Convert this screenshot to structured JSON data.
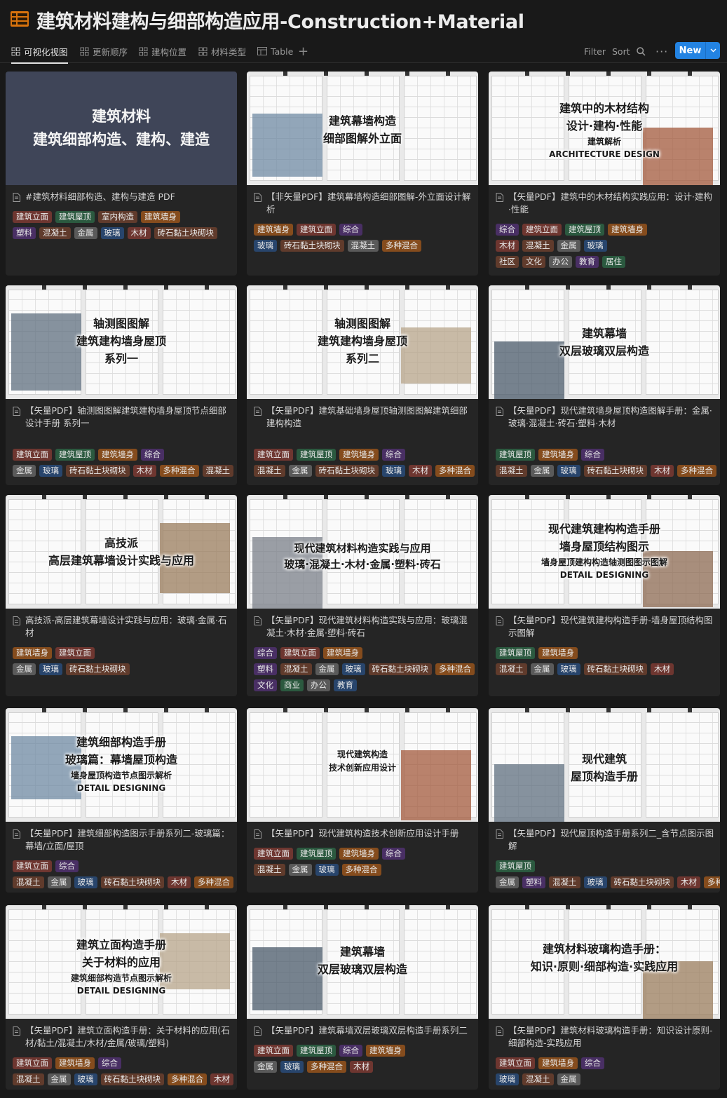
{
  "header": {
    "title": "建筑材料建构与细部构造应用-Construction+Material",
    "icon": "database-icon"
  },
  "tabs": [
    {
      "label": "可视化视图",
      "active": true
    },
    {
      "label": "更新顺序"
    },
    {
      "label": "建构位置"
    },
    {
      "label": "材料类型"
    },
    {
      "label": "Table"
    }
  ],
  "toolbar": {
    "filter": "Filter",
    "sort": "Sort",
    "new": "New"
  },
  "colors": {
    "accent": "#2383e2",
    "background": "#191919",
    "card": "#252525"
  },
  "cards": [
    {
      "cover": [
        "建筑材料",
        "建筑细部构造、建构、建造"
      ],
      "title": "#建筑材料细部构造、建构与建造 PDF",
      "tags": [
        [
          [
            "建筑立面",
            "red"
          ],
          [
            "建筑屋顶",
            "green"
          ],
          [
            "室内构造",
            "brown"
          ],
          [
            "建筑墙身",
            "orange"
          ]
        ],
        [
          [
            "塑料",
            "purple"
          ],
          [
            "混凝土",
            "brown"
          ],
          [
            "金属",
            "gray"
          ],
          [
            "玻璃",
            "blue"
          ],
          [
            "木材",
            "red"
          ],
          [
            "砖石黏土块砌块",
            "brown"
          ]
        ]
      ]
    },
    {
      "cover": [
        "建筑幕墙构造",
        "细部图解外立面"
      ],
      "title": "【非矢量PDF】建筑幕墙构造细部图解-外立面设计解析",
      "tags": [
        [
          [
            "建筑墙身",
            "orange"
          ],
          [
            "建筑立面",
            "red"
          ],
          [
            "综合",
            "purple"
          ]
        ],
        [
          [
            "玻璃",
            "blue"
          ],
          [
            "砖石黏土块砌块",
            "brown"
          ],
          [
            "混凝土",
            "gray"
          ],
          [
            "多种混合",
            "orange"
          ]
        ]
      ]
    },
    {
      "cover": [
        "建筑中的木材结构",
        "设计·建构·性能",
        "建筑解析",
        "ARCHITECTURE DESIGN"
      ],
      "title": "【矢量PDF】建筑中的木材结构实践应用：设计·建构·性能",
      "tags": [
        [
          [
            "综合",
            "purple"
          ],
          [
            "建筑立面",
            "red"
          ],
          [
            "建筑屋顶",
            "green"
          ],
          [
            "建筑墙身",
            "orange"
          ]
        ],
        [
          [
            "木材",
            "red"
          ],
          [
            "混凝土",
            "brown"
          ],
          [
            "金属",
            "gray"
          ],
          [
            "玻璃",
            "blue"
          ]
        ],
        [
          [
            "社区",
            "brown"
          ],
          [
            "文化",
            "brown"
          ],
          [
            "办公",
            "gray"
          ],
          [
            "教育",
            "purple"
          ],
          [
            "居住",
            "green"
          ]
        ]
      ]
    },
    {
      "cover": [
        "轴测图图解",
        "建筑建构墙身屋顶",
        "系列一"
      ],
      "title": "【矢量PDF】轴测图图解建筑建构墙身屋顶节点细部设计手册 系列一",
      "tags": [
        [
          [
            "建筑立面",
            "red"
          ],
          [
            "建筑屋顶",
            "green"
          ],
          [
            "建筑墙身",
            "orange"
          ],
          [
            "综合",
            "purple"
          ]
        ],
        [
          [
            "金属",
            "gray"
          ],
          [
            "玻璃",
            "blue"
          ],
          [
            "砖石黏土块砌块",
            "brown"
          ],
          [
            "木材",
            "red"
          ],
          [
            "多种混合",
            "orange"
          ],
          [
            "混凝土",
            "brown"
          ]
        ]
      ]
    },
    {
      "cover": [
        "轴测图图解",
        "建筑建构墙身屋顶",
        "系列二"
      ],
      "title": "【矢量PDF】建筑基础墙身屋顶轴测图图解建筑细部建构构造",
      "tags": [
        [
          [
            "建筑立面",
            "red"
          ],
          [
            "建筑屋顶",
            "green"
          ],
          [
            "建筑墙身",
            "orange"
          ],
          [
            "综合",
            "purple"
          ]
        ],
        [
          [
            "混凝土",
            "brown"
          ],
          [
            "金属",
            "gray"
          ],
          [
            "砖石黏土块砌块",
            "brown"
          ],
          [
            "玻璃",
            "blue"
          ],
          [
            "木材",
            "red"
          ],
          [
            "多种混合",
            "orange"
          ]
        ]
      ]
    },
    {
      "cover": [
        "建筑幕墙",
        "双层玻璃双层构造"
      ],
      "title": "【矢量PDF】现代建筑墙身屋顶构造图解手册：金属·玻璃·混凝土·砖石·塑料·木材",
      "tags": [
        [
          [
            "建筑屋顶",
            "green"
          ],
          [
            "建筑墙身",
            "orange"
          ],
          [
            "综合",
            "purple"
          ]
        ],
        [
          [
            "混凝土",
            "brown"
          ],
          [
            "金属",
            "gray"
          ],
          [
            "玻璃",
            "blue"
          ],
          [
            "砖石黏土块砌块",
            "brown"
          ],
          [
            "木材",
            "red"
          ],
          [
            "多种混合",
            "orange"
          ]
        ]
      ]
    },
    {
      "cover": [
        "高技派",
        "高层建筑幕墙设计实践与应用"
      ],
      "title": "高技派-高层建筑幕墙设计实践与应用：玻璃·金属·石材",
      "tags": [
        [
          [
            "建筑墙身",
            "orange"
          ],
          [
            "建筑立面",
            "red"
          ]
        ],
        [
          [
            "金属",
            "gray"
          ],
          [
            "玻璃",
            "blue"
          ],
          [
            "砖石黏土块砌块",
            "brown"
          ]
        ]
      ]
    },
    {
      "cover": [
        "现代建筑材料构造实践与应用",
        "玻璃·混凝土·木材·金属·塑料·砖石"
      ],
      "title": "【矢量PDF】现代建筑材料构造实践与应用：玻璃混凝土·木材·金属·塑料·砖石",
      "tags": [
        [
          [
            "综合",
            "purple"
          ],
          [
            "建筑立面",
            "red"
          ],
          [
            "建筑墙身",
            "orange"
          ]
        ],
        [
          [
            "塑料",
            "purple"
          ],
          [
            "混凝土",
            "brown"
          ],
          [
            "金属",
            "gray"
          ],
          [
            "玻璃",
            "blue"
          ],
          [
            "砖石黏土块砌块",
            "brown"
          ],
          [
            "多种混合",
            "orange"
          ]
        ],
        [
          [
            "文化",
            "purple"
          ],
          [
            "商业",
            "green"
          ],
          [
            "办公",
            "gray"
          ],
          [
            "教育",
            "blue"
          ]
        ]
      ]
    },
    {
      "cover": [
        "现代建筑建构构造手册",
        "墙身屋顶结构图示",
        "墙身屋顶建构构造轴测图图示图解",
        "DETAIL DESIGNING"
      ],
      "title": "【矢量PDF】现代建筑建构构造手册-墙身屋顶结构图示图解",
      "tags": [
        [
          [
            "建筑屋顶",
            "green"
          ],
          [
            "建筑墙身",
            "orange"
          ]
        ],
        [
          [
            "混凝土",
            "brown"
          ],
          [
            "金属",
            "gray"
          ],
          [
            "玻璃",
            "blue"
          ],
          [
            "砖石黏土块砌块",
            "brown"
          ],
          [
            "木材",
            "red"
          ]
        ]
      ]
    },
    {
      "cover": [
        "建筑细部构造手册",
        "玻璃篇：幕墙屋顶构造",
        "墙身屋顶构造节点图示解析",
        "DETAIL DESIGNING"
      ],
      "title": "【矢量PDF】建筑细部构造图示手册系列二-玻璃篇：幕墙/立面/屋顶",
      "tags": [
        [
          [
            "建筑立面",
            "red"
          ],
          [
            "综合",
            "purple"
          ]
        ],
        [
          [
            "混凝土",
            "brown"
          ],
          [
            "金属",
            "gray"
          ],
          [
            "玻璃",
            "blue"
          ],
          [
            "砖石黏土块砌块",
            "brown"
          ],
          [
            "木材",
            "red"
          ],
          [
            "多种混合",
            "orange"
          ]
        ]
      ]
    },
    {
      "cover": [
        "现代建筑构造",
        "技术创新应用设计"
      ],
      "title": "【矢量PDF】现代建筑构造技术创新应用设计手册",
      "tags": [
        [
          [
            "建筑立面",
            "red"
          ],
          [
            "建筑屋顶",
            "green"
          ],
          [
            "建筑墙身",
            "orange"
          ],
          [
            "综合",
            "purple"
          ]
        ],
        [
          [
            "混凝土",
            "brown"
          ],
          [
            "金属",
            "gray"
          ],
          [
            "玻璃",
            "blue"
          ],
          [
            "多种混合",
            "orange"
          ]
        ]
      ]
    },
    {
      "cover": [
        "现代建筑",
        "屋顶构造手册"
      ],
      "title": "【矢量PDF】现代屋顶构造手册系列二_含节点图示图解",
      "tags": [
        [
          [
            "建筑屋顶",
            "green"
          ]
        ],
        [
          [
            "金属",
            "gray"
          ],
          [
            "塑料",
            "purple"
          ],
          [
            "混凝土",
            "brown"
          ],
          [
            "玻璃",
            "blue"
          ],
          [
            "砖石黏土块砌块",
            "brown"
          ],
          [
            "木材",
            "red"
          ],
          [
            "多种混合",
            "orange"
          ]
        ]
      ]
    },
    {
      "cover": [
        "建筑立面构造手册",
        "关于材料的应用",
        "建筑细部构造节点图示解析",
        "DETAIL DESIGNING"
      ],
      "title": "【矢量PDF】建筑立面构造手册：关于材料的应用(石材/黏土/混凝土/木材/金属/玻璃/塑料)",
      "tags": [
        [
          [
            "建筑立面",
            "red"
          ],
          [
            "建筑墙身",
            "orange"
          ],
          [
            "综合",
            "purple"
          ]
        ],
        [
          [
            "混凝土",
            "brown"
          ],
          [
            "金属",
            "gray"
          ],
          [
            "玻璃",
            "blue"
          ],
          [
            "砖石黏土块砌块",
            "brown"
          ],
          [
            "多种混合",
            "orange"
          ],
          [
            "木材",
            "red"
          ]
        ]
      ]
    },
    {
      "cover": [
        "建筑幕墙",
        "双层玻璃双层构造"
      ],
      "title": "【矢量PDF】建筑幕墙双层玻璃双层构造手册系列二",
      "tags": [
        [
          [
            "建筑立面",
            "red"
          ],
          [
            "建筑屋顶",
            "green"
          ],
          [
            "综合",
            "purple"
          ],
          [
            "建筑墙身",
            "orange"
          ]
        ],
        [
          [
            "金属",
            "gray"
          ],
          [
            "玻璃",
            "blue"
          ],
          [
            "多种混合",
            "orange"
          ],
          [
            "木材",
            "red"
          ]
        ]
      ]
    },
    {
      "cover": [
        "建筑材料玻璃构造手册：",
        "知识·原则·细部构造·实践应用"
      ],
      "title": "【矢量PDF】建筑材料玻璃构造手册：知识设计原则-细部构造-实践应用",
      "tags": [
        [
          [
            "建筑立面",
            "red"
          ],
          [
            "建筑墙身",
            "orange"
          ],
          [
            "综合",
            "purple"
          ]
        ],
        [
          [
            "玻璃",
            "blue"
          ],
          [
            "混凝土",
            "brown"
          ],
          [
            "金属",
            "gray"
          ]
        ]
      ]
    }
  ]
}
